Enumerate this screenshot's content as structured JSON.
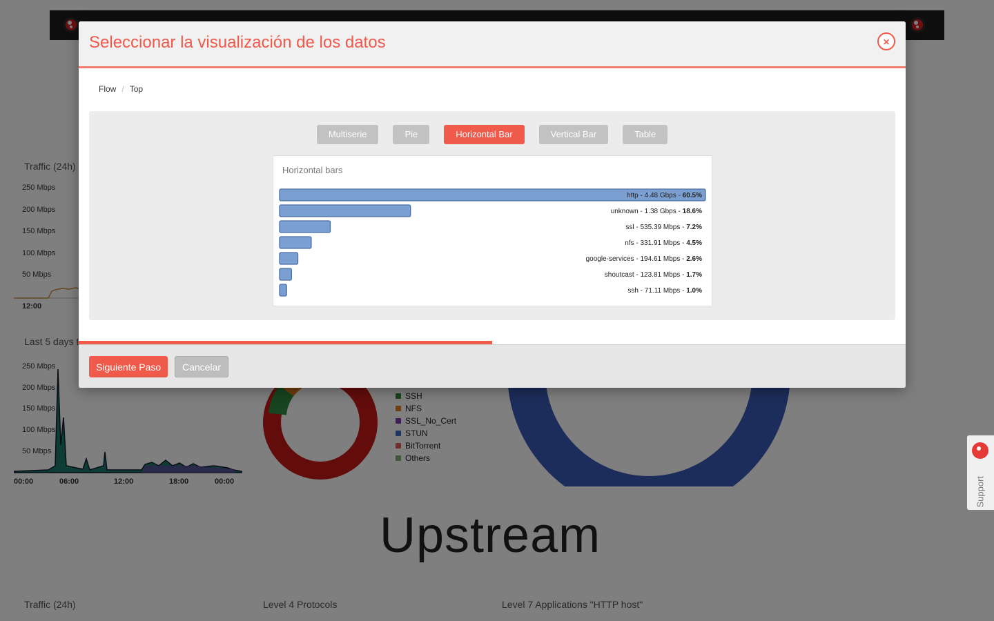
{
  "background": {
    "traffic_24h_title": "Traffic (24h)",
    "last5days_title": "Last 5 days t",
    "traffic_y_labels": [
      "250 Mbps",
      "200 Mbps",
      "150 Mbps",
      "100 Mbps",
      "50 Mbps"
    ],
    "traffic_x_label": "12:00",
    "days_y_labels": [
      "250 Mbps",
      "200 Mbps",
      "150 Mbps",
      "100 Mbps",
      "50 Mbps"
    ],
    "days_x_labels": [
      "00:00",
      "06:00",
      "12:00",
      "18:00",
      "00:00"
    ],
    "legend": [
      {
        "label": "SSH",
        "color": "#2e8b3e"
      },
      {
        "label": "NFS",
        "color": "#e07b1a"
      },
      {
        "label": "SSL_No_Cert",
        "color": "#7b3fb0"
      },
      {
        "label": "STUN",
        "color": "#3a6fc4"
      },
      {
        "label": "BitTorrent",
        "color": "#e05a5a"
      },
      {
        "label": "Others",
        "color": "#7cb26a"
      }
    ],
    "upstream_heading": "Upstream",
    "bottom_titles": [
      "Traffic (24h)",
      "Level 4 Protocols",
      "Level 7 Applications \"HTTP host\""
    ],
    "support_label": "Support"
  },
  "modal": {
    "title": "Seleccionar la visualización de los datos",
    "close_symbol": "×",
    "breadcrumb": [
      "Flow",
      "Top"
    ],
    "viz_options": [
      {
        "label": "Multiserie",
        "active": false
      },
      {
        "label": "Pie",
        "active": false
      },
      {
        "label": "Horizontal Bar",
        "active": true
      },
      {
        "label": "Vertical Bar",
        "active": false
      },
      {
        "label": "Table",
        "active": false
      }
    ],
    "progress_fraction": 0.5,
    "next_label": "Siguiente Paso",
    "cancel_label": "Cancelar"
  },
  "colors": {
    "accent": "#f05a4b",
    "bar_fill": "#7b9fd1",
    "bar_stroke": "#4a6fa5"
  },
  "chart_data": {
    "type": "bar",
    "orientation": "horizontal",
    "title": "Horizontal bars",
    "bars": [
      {
        "name": "http",
        "value_label": "4.48 Gbps",
        "percent": 60.5
      },
      {
        "name": "unknown",
        "value_label": "1.38 Gbps",
        "percent": 18.6
      },
      {
        "name": "ssl",
        "value_label": "535.39 Mbps",
        "percent": 7.2
      },
      {
        "name": "nfs",
        "value_label": "331.91 Mbps",
        "percent": 4.5
      },
      {
        "name": "google-services",
        "value_label": "194.61 Mbps",
        "percent": 2.6
      },
      {
        "name": "shoutcast",
        "value_label": "123.81 Mbps",
        "percent": 1.7
      },
      {
        "name": "ssh",
        "value_label": "71.11 Mbps",
        "percent": 1.0
      }
    ]
  }
}
